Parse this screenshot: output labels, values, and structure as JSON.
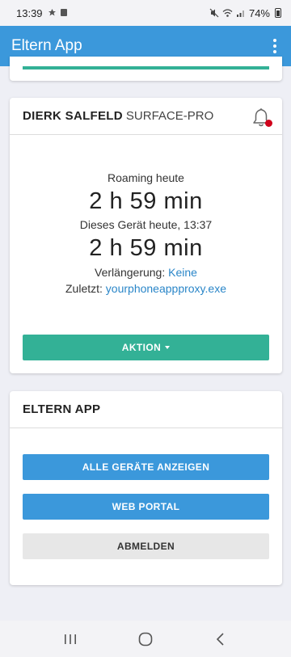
{
  "status_bar": {
    "time": "13:39",
    "battery": "74%",
    "left_icons": [
      "notification-icon",
      "gallery-icon"
    ],
    "right_icons": [
      "mute-icon",
      "wifi-icon",
      "signal-icon",
      "battery-icon"
    ]
  },
  "app_bar": {
    "title": "Eltern App",
    "menu_icon": "more-vert-icon"
  },
  "device_card": {
    "name": "DIERK SALFELD",
    "model": "SURFACE-PRO",
    "bell_icon": "bell-icon",
    "roaming_label": "Roaming heute",
    "roaming_time": "2 h 59 min",
    "device_label": "Dieses Gerät heute, 13:37",
    "device_time": "2 h 59 min",
    "extension_label": "Verlängerung:",
    "extension_value": "Keine",
    "last_label": "Zuletzt:",
    "last_value": "yourphoneappproxy.exe",
    "action_label": "AKTION"
  },
  "app_card": {
    "title": "ELTERN APP",
    "buttons": [
      {
        "label": "ALLE GERÄTE ANZEIGEN"
      },
      {
        "label": "WEB PORTAL"
      },
      {
        "label": "ABMELDEN"
      }
    ]
  },
  "nav_bar": {
    "icons": [
      "recent-apps-icon",
      "home-icon",
      "back-icon"
    ]
  },
  "colors": {
    "primary": "#3b98db",
    "accent": "#33b196",
    "link": "#2a86c8",
    "notification_dot": "#d0021b"
  }
}
